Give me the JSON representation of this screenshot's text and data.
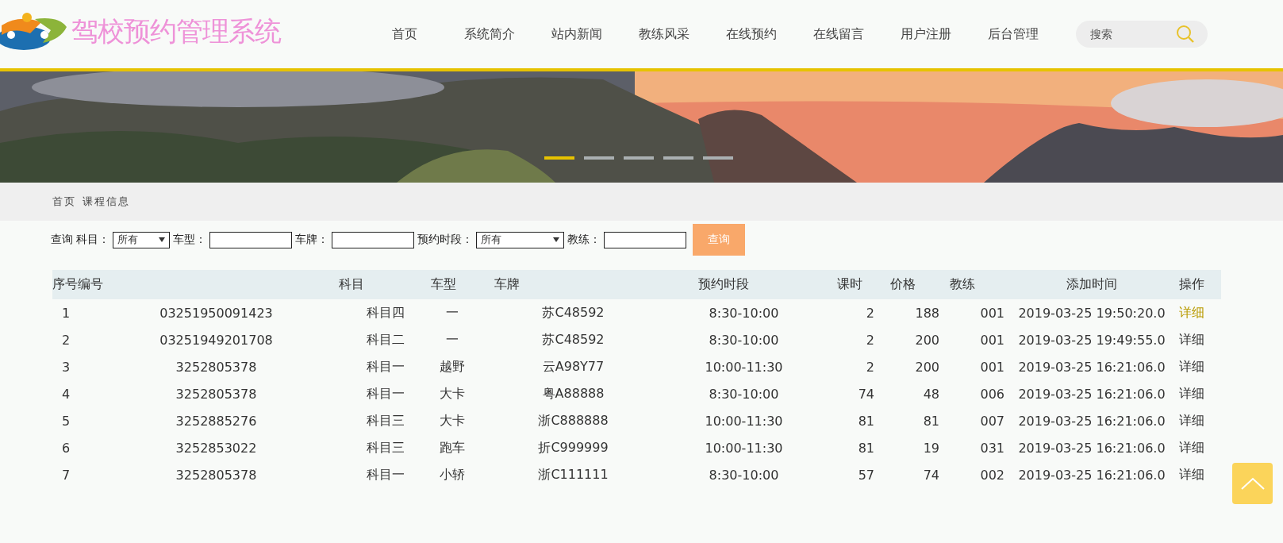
{
  "header": {
    "site_title": "驾校预约管理系统",
    "nav": [
      {
        "label": "首页"
      },
      {
        "label": "系统简介"
      },
      {
        "label": "站内新闻"
      },
      {
        "label": "教练风采"
      },
      {
        "label": "在线预约"
      },
      {
        "label": "在线留言"
      },
      {
        "label": "用户注册"
      },
      {
        "label": "后台管理"
      }
    ],
    "search": {
      "placeholder": "搜索"
    }
  },
  "banner": {
    "kind": "picture",
    "slides": [
      {
        "selected": true
      },
      {
        "selected": false
      },
      {
        "selected": false
      },
      {
        "selected": false
      },
      {
        "selected": false
      }
    ]
  },
  "breadcrumb": [
    "首页",
    "课程信息"
  ],
  "query": {
    "label": "查询",
    "fields": [
      {
        "kind": "select",
        "label": "科目：",
        "value": "所有"
      },
      {
        "kind": "input",
        "label": "车型："
      },
      {
        "kind": "input",
        "label": "车牌："
      },
      {
        "kind": "select",
        "label": "预约时段：",
        "value": "所有",
        "wide": true
      },
      {
        "kind": "input",
        "label": "教练："
      }
    ],
    "button": "查询"
  },
  "table": {
    "columns": [
      "序号编号",
      "",
      "科目",
      "车型",
      "车牌",
      "预约时段",
      "课时",
      "价格",
      "教练",
      "添加时间",
      "操作"
    ],
    "rows": [
      {
        "cells": [
          "1",
          "03251950091423",
          "科目四",
          "一",
          "苏C48592",
          "8:30-10:00",
          "2",
          "188",
          "001",
          "2019-03-25 19:50:20.0"
        ],
        "action": "详细",
        "hovered": true
      },
      {
        "cells": [
          "2",
          "03251949201708",
          "科目二",
          "一",
          "苏C48592",
          "8:30-10:00",
          "2",
          "200",
          "001",
          "2019-03-25 19:49:55.0"
        ],
        "action": "详细",
        "hovered": false
      },
      {
        "cells": [
          "3",
          "3252805378",
          "科目一",
          "越野",
          "云A98Y77",
          "10:00-11:30",
          "2",
          "200",
          "001",
          "2019-03-25 16:21:06.0"
        ],
        "action": "详细",
        "hovered": false
      },
      {
        "cells": [
          "4",
          "3252805378",
          "科目一",
          "大卡",
          "粤A88888",
          "8:30-10:00",
          "74",
          "48",
          "006",
          "2019-03-25 16:21:06.0"
        ],
        "action": "详细",
        "hovered": false
      },
      {
        "cells": [
          "5",
          "3252885276",
          "科目三",
          "大卡",
          "浙C888888",
          "10:00-11:30",
          "81",
          "81",
          "007",
          "2019-03-25 16:21:06.0"
        ],
        "action": "详细",
        "hovered": false
      },
      {
        "cells": [
          "6",
          "3252853022",
          "科目三",
          "跑车",
          "折C999999",
          "10:00-11:30",
          "81",
          "19",
          "031",
          "2019-03-25 16:21:06.0"
        ],
        "action": "详细",
        "hovered": false
      },
      {
        "cells": [
          "7",
          "3252805378",
          "科目一",
          "小轿",
          "浙C111111",
          "8:30-10:00",
          "57",
          "74",
          "002",
          "2019-03-25 16:21:06.0"
        ],
        "action": "详细",
        "hovered": false
      }
    ]
  }
}
